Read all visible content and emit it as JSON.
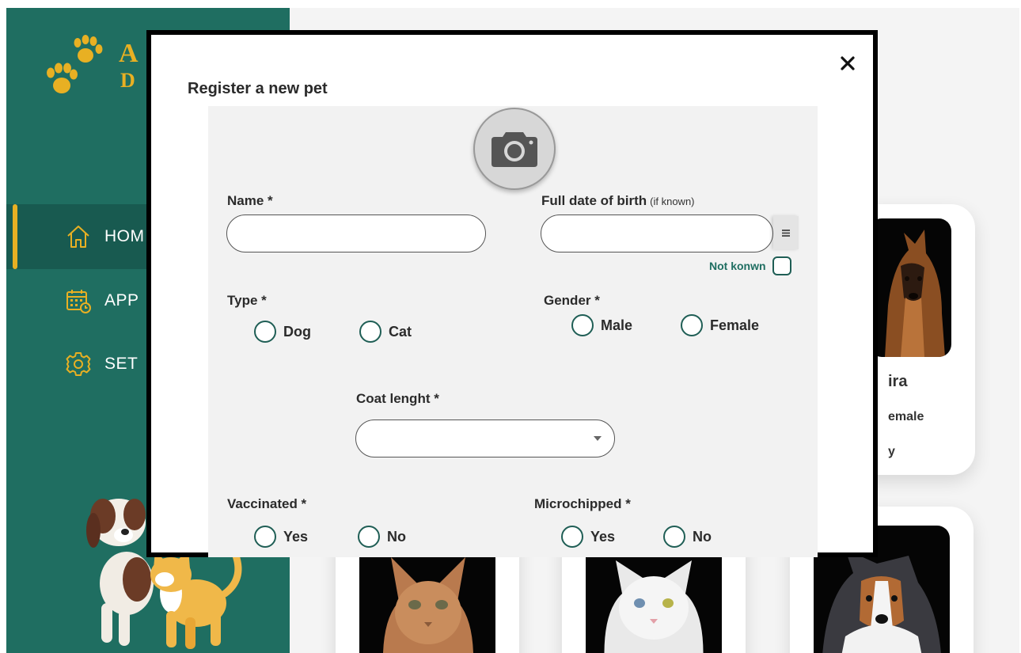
{
  "sidebar": {
    "logo": {
      "line1": "A",
      "line2": "D"
    },
    "nav": [
      {
        "label": "HOM",
        "icon": "home-icon"
      },
      {
        "label": "APP",
        "icon": "calendar-icon"
      },
      {
        "label": "SET",
        "icon": "gear-icon"
      }
    ]
  },
  "cards": {
    "top_right": {
      "name": "ira",
      "gender": "emale",
      "extra": "y"
    }
  },
  "modal": {
    "title": "Register a new pet",
    "close_label": "✕",
    "fields": {
      "name": {
        "label": "Name *",
        "value": "",
        "placeholder": ""
      },
      "dob": {
        "label": "Full date of birth",
        "hint": "(if known)",
        "value": "",
        "placeholder": ""
      },
      "not_known": "Not konwn",
      "type": {
        "label": "Type *",
        "options": [
          "Dog",
          "Cat"
        ]
      },
      "gender": {
        "label": "Gender *",
        "options": [
          "Male",
          "Female"
        ]
      },
      "coat": {
        "label": "Coat lenght *",
        "value": ""
      },
      "vaccinated": {
        "label": "Vaccinated *",
        "options": [
          "Yes",
          "No"
        ]
      },
      "microchipped": {
        "label": "Microchipped *",
        "options": [
          "Yes",
          "No"
        ]
      }
    }
  },
  "colors": {
    "sidebar": "#1f6e61",
    "accent": "#e8b023",
    "radio_border": "#1f5e55"
  }
}
